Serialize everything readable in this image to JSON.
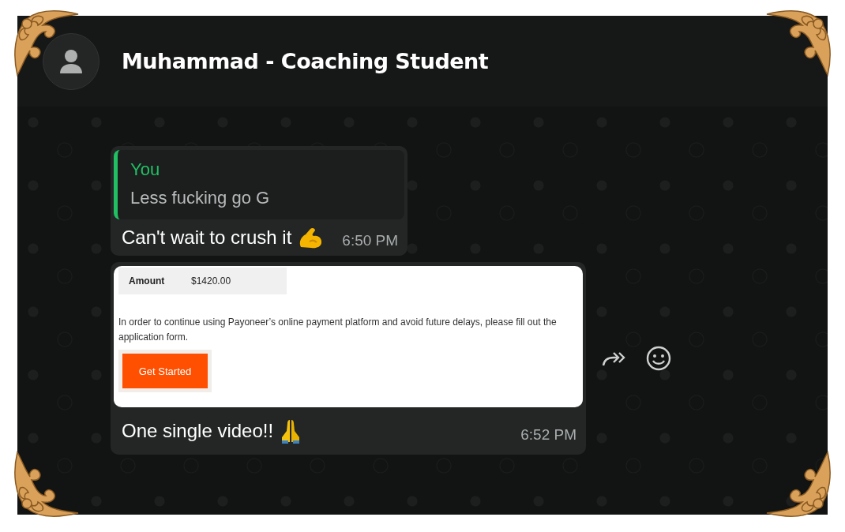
{
  "chat": {
    "title": "Muhammad - Coaching Student"
  },
  "messages": [
    {
      "kind": "reply",
      "quote": {
        "author": "You",
        "text": "Less fucking go G"
      },
      "text": "Can't wait to crush it",
      "time": "6:50 PM"
    },
    {
      "kind": "image",
      "card": {
        "amount_label": "Amount",
        "amount": "$1420.00",
        "body": "In order to continue using Payoneer’s online payment platform and avoid future delays, please fill out the application form.",
        "button": "Get Started"
      },
      "text": "One single video!!",
      "time": "6:52 PM"
    }
  ]
}
